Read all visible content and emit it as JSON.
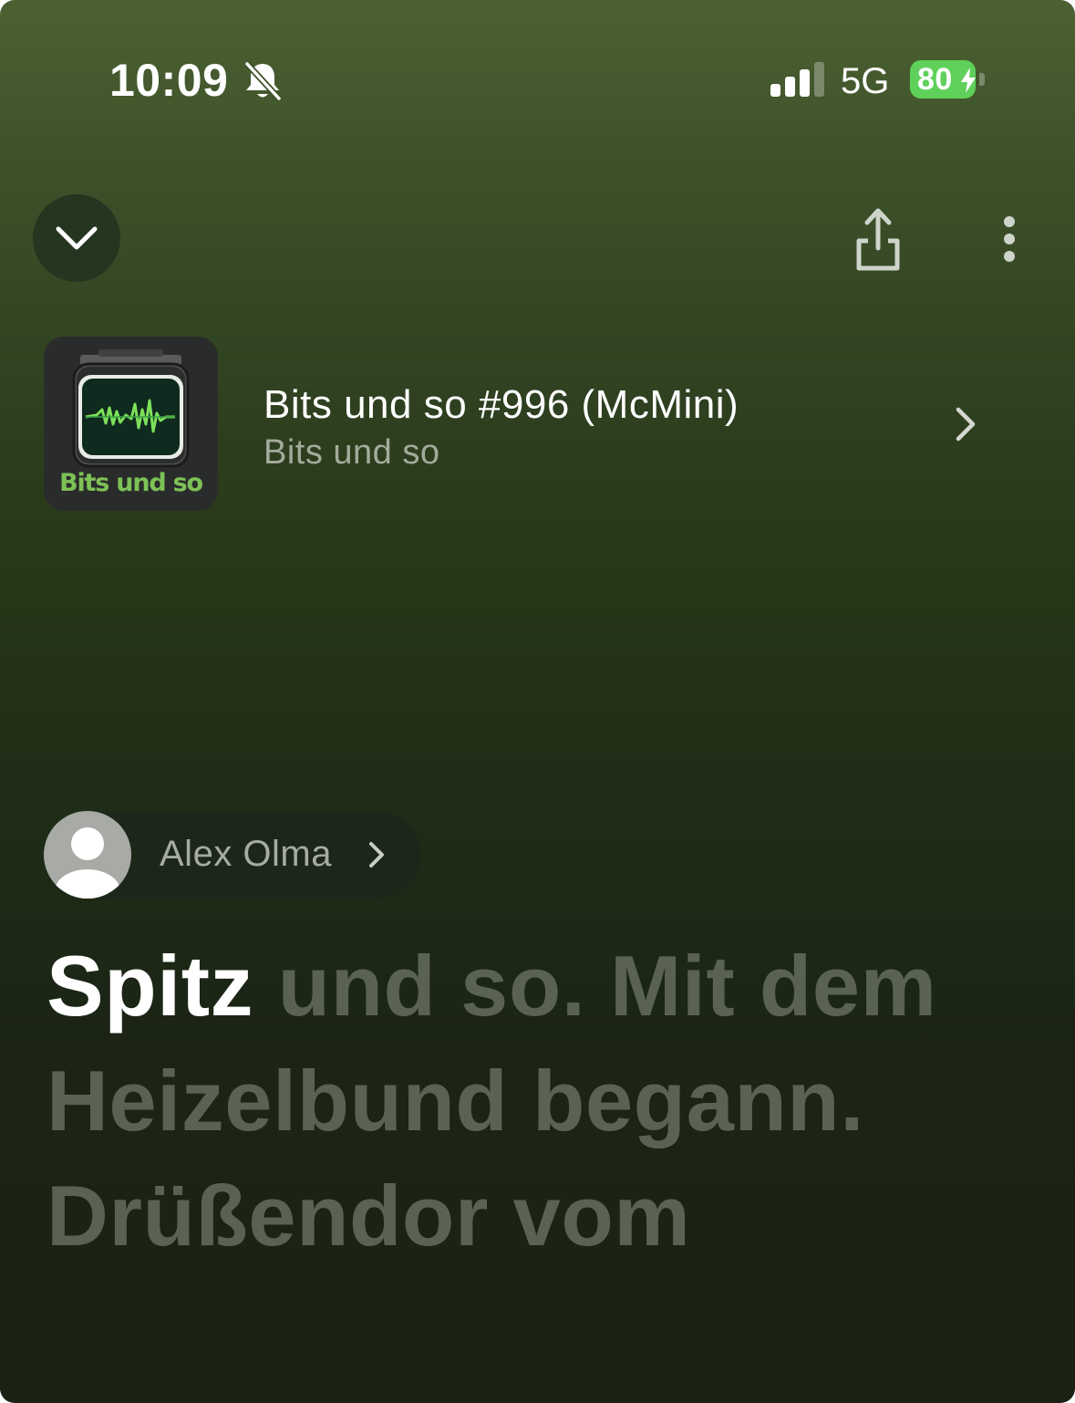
{
  "status_bar": {
    "time": "10:09",
    "network": "5G",
    "battery": "80",
    "icons": [
      "bell-slash-icon",
      "signal-icon",
      "battery-charging-icon"
    ]
  },
  "toolbar": {
    "collapse_icon": "chevron-down-icon",
    "share_icon": "share-icon",
    "more_icon": "more-vertical-icon"
  },
  "episode": {
    "title": "Bits und so #996 (McMini)",
    "show": "Bits und so",
    "artwork_text": "Bits und so",
    "chevron_icon": "chevron-right-icon"
  },
  "speaker": {
    "name": "Alex Olma",
    "avatar_icon": "person-icon",
    "chevron_icon": "chevron-right-icon"
  },
  "transcript": {
    "current_word": "Spitz",
    "upcoming_text": "und so. Mit dem Heizelbund begann. Drüßendor vom"
  },
  "colors": {
    "accent_green": "#7dc256",
    "battery_green": "#5fd05a",
    "upcoming_text": "#5a6253",
    "background_top": "#4b6132",
    "background_bottom": "#1a2214"
  }
}
